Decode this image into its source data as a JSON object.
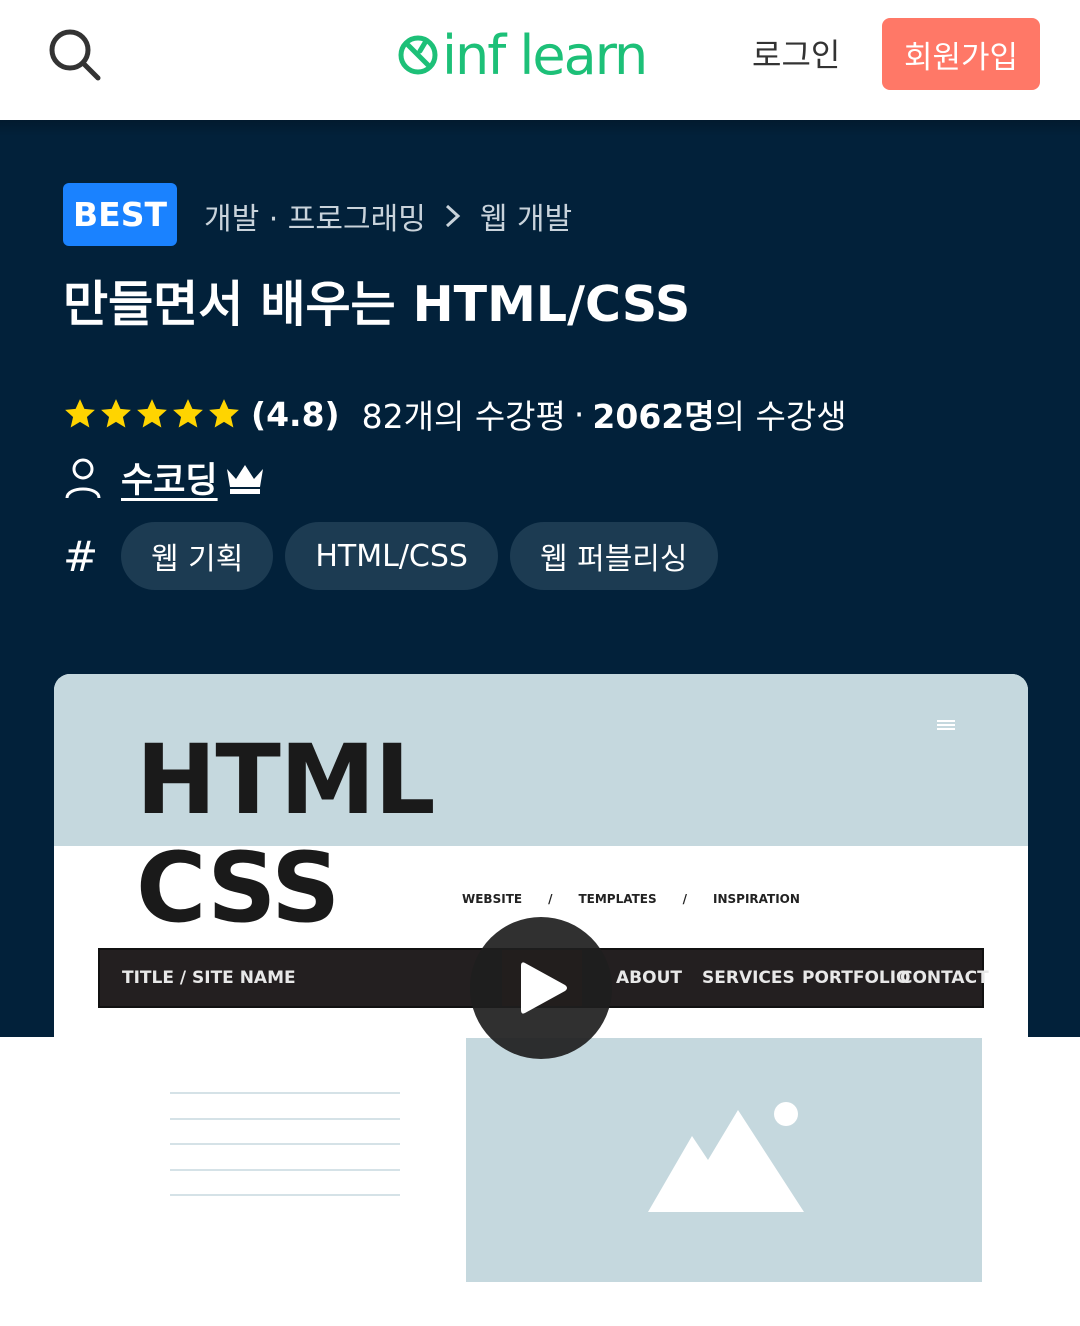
{
  "header": {
    "search_icon": "search-icon",
    "logo_text": "inf learn",
    "login_label": "로그인",
    "signup_label": "회원가입",
    "brand_color": "#1dc078",
    "signup_color": "#ff7867"
  },
  "course": {
    "badge": "BEST",
    "breadcrumb": {
      "category": "개발 · 프로그래밍",
      "subcategory": "웹 개발"
    },
    "title": "만들면서 배우는 HTML/CSS",
    "rating": 4.8,
    "stars_filled": 5,
    "rating_text": "(4.8)",
    "reviews_text": "82개의 수강평",
    "separator": "·",
    "students_count": "2062명",
    "students_suffix": "의 수강생",
    "author": "수코딩",
    "tags": [
      "웹 기획",
      "HTML/CSS",
      "웹 퍼블리싱"
    ],
    "tags_icon": "#"
  },
  "thumbnail": {
    "heading_1": "HTML",
    "heading_2": "CSS",
    "crumb": [
      "WEBSITE",
      "/",
      "TEMPLATES",
      "/",
      "INSPIRATION"
    ],
    "nav_title": "TITLE / SITE NAME",
    "nav_items": [
      "ABOUT",
      "SERVICES",
      "PORTFOLIO",
      "CONTACT"
    ],
    "play_icon": "play-icon",
    "image_icon": "mountain-image-icon"
  },
  "colors": {
    "hero_bg": "#02213a",
    "badge_bg": "#1a82ff",
    "tag_bg": "#1c3b52",
    "star": "#ffd400"
  }
}
